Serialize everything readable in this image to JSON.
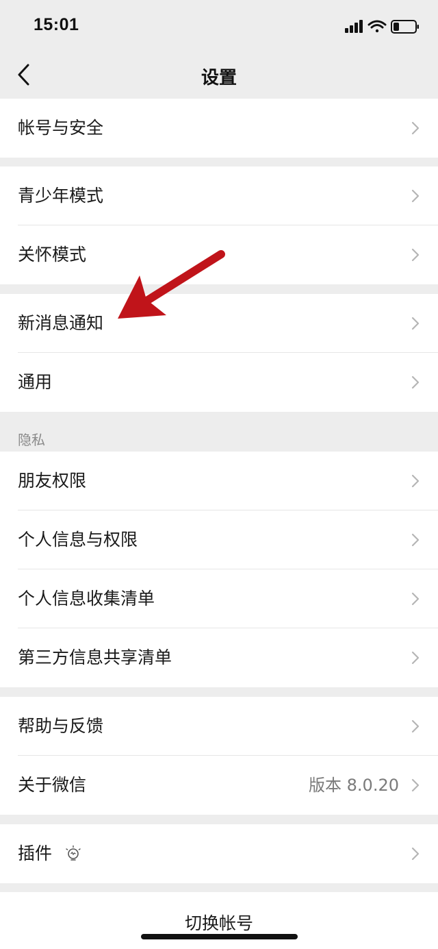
{
  "status_bar": {
    "time": "15:01",
    "icons": [
      "signal-icon",
      "wifi-icon",
      "battery-icon"
    ]
  },
  "nav": {
    "title": "设置",
    "back_icon": "chevron-left-icon"
  },
  "groups": [
    {
      "items": [
        {
          "label": "帐号与安全"
        }
      ]
    },
    {
      "items": [
        {
          "label": "青少年模式"
        },
        {
          "label": "关怀模式"
        }
      ]
    },
    {
      "items": [
        {
          "label": "新消息通知"
        },
        {
          "label": "通用"
        }
      ]
    },
    {
      "header": "隐私",
      "items": [
        {
          "label": "朋友权限"
        },
        {
          "label": "个人信息与权限"
        },
        {
          "label": "个人信息收集清单"
        },
        {
          "label": "第三方信息共享清单"
        }
      ]
    },
    {
      "items": [
        {
          "label": "帮助与反馈"
        },
        {
          "label": "关于微信",
          "value": "版本 8.0.20"
        }
      ]
    },
    {
      "items": [
        {
          "label": "插件",
          "icon": "lightbulb-icon"
        }
      ]
    }
  ],
  "switch_account": "切换帐号",
  "colors": {
    "background": "#ededed",
    "row_bg": "#ffffff",
    "annotation_arrow": "#c0141a"
  }
}
